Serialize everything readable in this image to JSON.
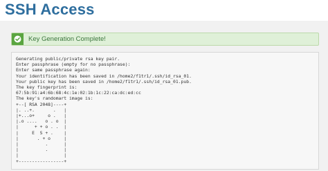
{
  "page": {
    "title": "SSH Access"
  },
  "alert": {
    "message": "Key Generation Complete!",
    "icon": "check-icon",
    "color": "#5aa540"
  },
  "output": {
    "lines": [
      "Generating public/private rsa key pair.",
      "Enter passphrase (empty for no passphrase):",
      "Enter same passphrase again:",
      "Your identification has been saved in /home2/f1tr1/.ssh/id_rsa_01.",
      "Your public key has been saved in /home2/f1tr1/.ssh/id_rsa_01.pub.",
      "The key fingerprint is:",
      "67:5b:91:a4:6b:68:4c:1e:02:1b:1c:22:ca:dc:ed:cc",
      "The key's randomart image is:",
      "+--[ RSA 2048]----+",
      "|. ..+.       .   |",
      "|+...o+     o .   |",
      "|.o ....   o . o  |",
      "|      + + o . .  |",
      "|     E  S + .    |",
      "|       . + o     |",
      "|          .      |",
      "|          .      |",
      "|                 |",
      "+-----------------+"
    ]
  }
}
